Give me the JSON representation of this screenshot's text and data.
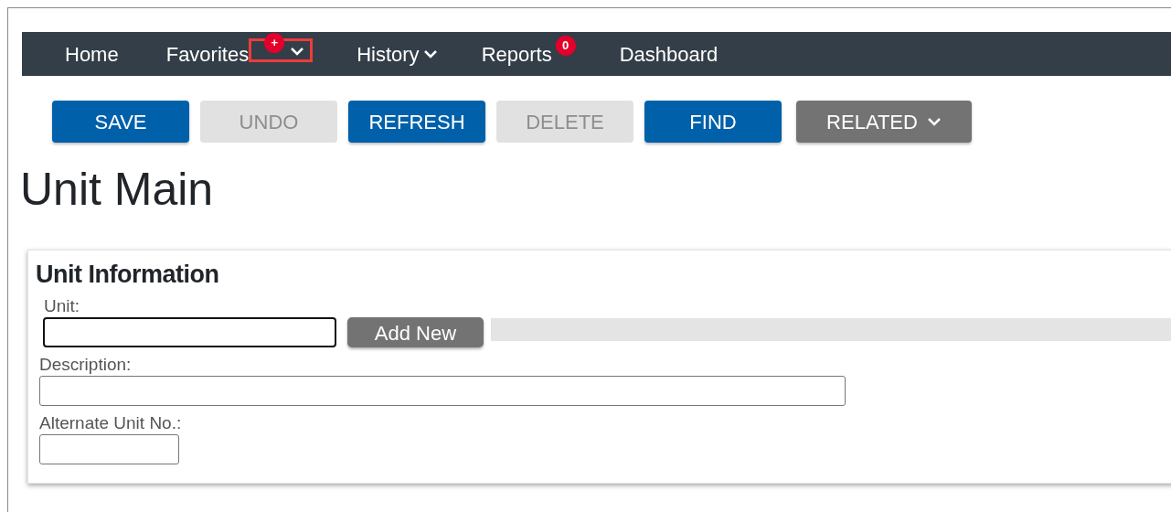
{
  "nav": [
    {
      "label": "Home",
      "dropdown": false,
      "highlighted": false
    },
    {
      "label": "Favorites",
      "badge": "+",
      "dropdown": true,
      "highlighted": true
    },
    {
      "label": "History",
      "dropdown": true,
      "highlighted": false
    },
    {
      "label": "Reports",
      "badge": "0",
      "dropdown": false,
      "highlighted": false
    },
    {
      "label": "Dashboard",
      "dropdown": false,
      "highlighted": false
    }
  ],
  "toolbar": [
    {
      "label": "SAVE",
      "kind": "primary",
      "disabled": false
    },
    {
      "label": "UNDO",
      "kind": "primary",
      "disabled": true
    },
    {
      "label": "REFRESH",
      "kind": "primary",
      "disabled": false
    },
    {
      "label": "DELETE",
      "kind": "primary",
      "disabled": true
    },
    {
      "label": "FIND",
      "kind": "primary",
      "disabled": false
    },
    {
      "label": "RELATED",
      "kind": "menu",
      "disabled": false
    }
  ],
  "page_title": "Unit Main",
  "section": {
    "title": "Unit Information",
    "fields": [
      {
        "label": "Unit:",
        "focused": true,
        "action": "Add New"
      },
      {
        "label": "Description:",
        "focused": false
      },
      {
        "label": "Alternate Unit No.:",
        "focused": false
      }
    ]
  }
}
